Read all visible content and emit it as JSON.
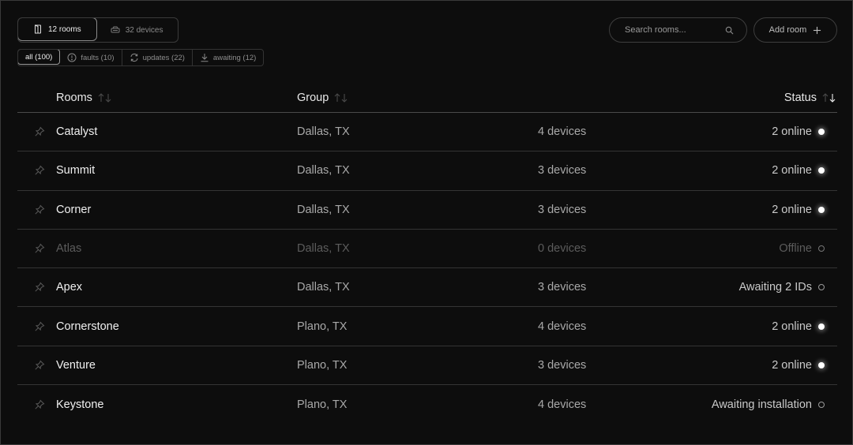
{
  "view_switch": {
    "rooms_label": "12 rooms",
    "devices_label": "32 devices"
  },
  "filters": {
    "all": "all (100)",
    "faults": "faults (10)",
    "updates": "updates (22)",
    "awaiting": "awaiting (12)"
  },
  "search": {
    "placeholder": "Search rooms..."
  },
  "add_room": {
    "label": "Add room"
  },
  "table": {
    "headers": {
      "rooms": "Rooms",
      "group": "Group",
      "status": "Status"
    },
    "rows": [
      {
        "name": "Catalyst",
        "group": "Dallas, TX",
        "devices": "4 devices",
        "status": "2 online",
        "state": "online"
      },
      {
        "name": "Summit",
        "group": "Dallas, TX",
        "devices": "3 devices",
        "status": "2 online",
        "state": "online"
      },
      {
        "name": "Corner",
        "group": "Dallas, TX",
        "devices": "3 devices",
        "status": "2 online",
        "state": "online"
      },
      {
        "name": "Atlas",
        "group": "Dallas, TX",
        "devices": "0 devices",
        "status": "Offline",
        "state": "offline"
      },
      {
        "name": "Apex",
        "group": "Dallas, TX",
        "devices": "3 devices",
        "status": "Awaiting 2 IDs",
        "state": "awaiting"
      },
      {
        "name": "Cornerstone",
        "group": "Plano, TX",
        "devices": "4 devices",
        "status": "2 online",
        "state": "online"
      },
      {
        "name": "Venture",
        "group": "Plano, TX",
        "devices": "3 devices",
        "status": "2 online",
        "state": "online"
      },
      {
        "name": "Keystone",
        "group": "Plano, TX",
        "devices": "4 devices",
        "status": "Awaiting installation",
        "state": "awaiting"
      }
    ]
  },
  "colors": {
    "background": "#0b0b0b",
    "online_dot": "#ffffff",
    "muted_text": "#a9a9a9"
  }
}
